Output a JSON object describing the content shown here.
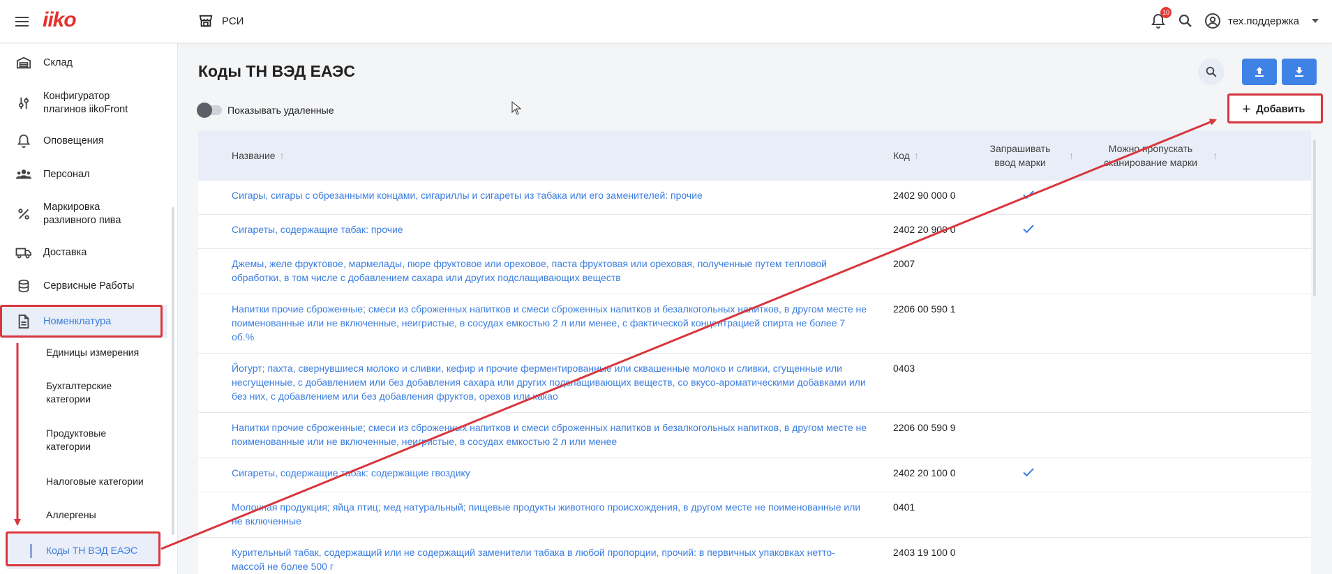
{
  "header": {
    "logo": "iiko",
    "store_name": "РСИ",
    "notifications_count": "10",
    "user_name": "тех.поддержка"
  },
  "sidebar": {
    "items": [
      {
        "label": "Склад",
        "icon": "warehouse-icon"
      },
      {
        "label": "Конфигуратор плагинов iikoFront",
        "icon": "sliders-icon"
      },
      {
        "label": "Оповещения",
        "icon": "bell-icon"
      },
      {
        "label": "Персонал",
        "icon": "people-icon"
      },
      {
        "label": "Маркировка разливного пива",
        "icon": "percent-icon"
      },
      {
        "label": "Доставка",
        "icon": "truck-icon"
      },
      {
        "label": "Сервисные Работы",
        "icon": "database-icon"
      },
      {
        "label": "Номенклатура",
        "icon": "document-icon"
      }
    ],
    "subitems": [
      {
        "label": "Единицы измерения"
      },
      {
        "label": "Бухгалтерские категории"
      },
      {
        "label": "Продуктовые категории"
      },
      {
        "label": "Налоговые категории"
      },
      {
        "label": "Аллергены"
      },
      {
        "label": "Коды ТН ВЭД ЕАЭС"
      }
    ]
  },
  "main": {
    "title": "Коды ТН ВЭД ЕАЭС",
    "show_deleted_label": "Показывать удаленные",
    "add_label": "Добавить",
    "columns": {
      "name": "Название",
      "code": "Код",
      "ask_mark": "Запрашивать ввод марки",
      "skip_scan": "Можно пропускать сканирование марки"
    },
    "rows": [
      {
        "name": "Сигары, сигары с обрезанными концами, сигариллы и сигареты из табака или его заменителей: прочие",
        "code": "2402 90 000 0",
        "ask_mark": true
      },
      {
        "name": "Сигареты, содержащие табак: прочие",
        "code": "2402 20 900 0",
        "ask_mark": true
      },
      {
        "name": "Джемы, желе фруктовое, мармелады, пюре фруктовое или ореховое, паста фруктовая или ореховая, полученные путем тепловой обработки, в том числе с добавлением сахара или других подслащивающих веществ",
        "code": "2007",
        "ask_mark": false
      },
      {
        "name": "Напитки прочие сброженные; смеси из сброженных напитков и смеси сброженных напитков и безалкогольных напитков, в другом месте не поименованные или не включенные, неигристые, в сосудах емкостью 2 л или менее, с фактической концентрацией спирта не более 7 об.%",
        "code": "2206 00 590 1",
        "ask_mark": false
      },
      {
        "name": "Йогурт; пахта, свернувшиеся молоко и сливки, кефир и прочие ферментированные или сквашенные молоко и сливки, сгущенные или несгущенные, с добавлением или без добавления сахара или других подслащивающих веществ, со вкусо-ароматическими добавками или без них, с добавлением или без добавления фруктов, орехов или какао",
        "code": "0403",
        "ask_mark": false
      },
      {
        "name": "Напитки прочие сброженные; смеси из сброженных напитков и смеси сброженных напитков и безалкогольных напитков, в другом месте не поименованные или не включенные, неигристые, в сосудах емкостью 2 л или менее",
        "code": "2206 00 590 9",
        "ask_mark": false
      },
      {
        "name": "Сигареты, содержащие табак: содержащие гвоздику",
        "code": "2402 20 100 0",
        "ask_mark": true
      },
      {
        "name": "Молочная продукция; яйца птиц; мед натуральный; пищевые продукты животного происхождения, в другом месте не поименованные или не включенные",
        "code": "0401",
        "ask_mark": false
      },
      {
        "name": "Курительный табак, содержащий или не содержащий заменители табака в любой пропорции, прочий: в первичных упаковках нетто-массой не более 500 г",
        "code": "2403 19 100 0",
        "ask_mark": false
      }
    ]
  },
  "colors": {
    "accent": "#3a7de0",
    "button_blue": "#3f82e6",
    "annotation_red": "#d9363e"
  }
}
